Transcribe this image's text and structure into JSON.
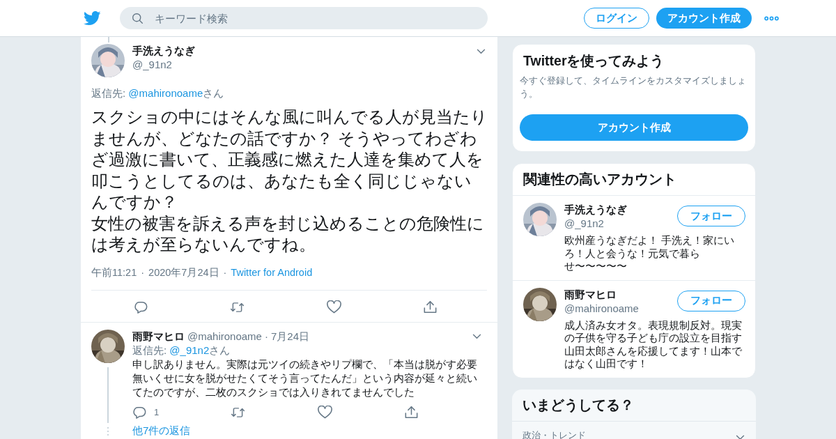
{
  "header": {
    "search": {
      "placeholder": "キーワード検索"
    },
    "login_button": "ログイン",
    "signup_button": "アカウント作成"
  },
  "tweet": {
    "name": "手洗えうなぎ",
    "handle": "@_91n2",
    "reply_to": {
      "prefix": "返信先:",
      "handle": "@mahironoame",
      "suffix": "さん"
    },
    "paragraphs": [
      "スクショの中にはそんな風に叫んでる人が見当たりませんが、どなたの話ですか？ そうやってわざわざ過激に書いて、正義感に燃えた人達を集めて人を叩こうとしてるのは、あなたも全く同じじゃないんですか？",
      "女性の被害を訴える声を封じ込めることの危険性には考えが至らないんですね。"
    ],
    "separator": "·",
    "time": "午前11:21",
    "date": "2020年7月24日",
    "source": "Twitter for Android",
    "actions": [
      {
        "kind": "reply"
      },
      {
        "kind": "retweet"
      },
      {
        "kind": "like"
      },
      {
        "kind": "share"
      }
    ]
  },
  "replies": [
    {
      "name": "雨野マヒロ",
      "handle": "@mahironoame",
      "separator": "·",
      "date": "7月24日",
      "reply_to": {
        "prefix": "返信先:",
        "handle": "@_91n2",
        "suffix": "さん"
      },
      "body": "申し訳ありません。実際は元ツイの続きやリプ欄で、「本当は脱がす必要無いくせに女を脱がせたくてそう言ってたんだ」という内容が延々と続いてたのですが、二枚のスクショでは入りきれてませんでした",
      "actions": [
        {
          "kind": "reply",
          "count": "1"
        },
        {
          "kind": "retweet"
        },
        {
          "kind": "like"
        },
        {
          "kind": "share"
        }
      ],
      "more_replies": "他7件の返信"
    }
  ],
  "sidebar": {
    "signup_card": {
      "title": "Twitterを使ってみよう",
      "text": "今すぐ登録して、タイムラインをカスタマイズしましょう。",
      "button": "アカウント作成"
    },
    "who_to_follow": {
      "title": "関連性の高いアカウント",
      "accounts": [
        {
          "name": "手洗えうなぎ",
          "handle": "@_91n2",
          "bio": "欧州産うなぎだよ！ 手洗え！家にいろ！人と会うな！元気で暮らせ〜〜〜〜〜",
          "button": "フォロー"
        },
        {
          "name": "雨野マヒロ",
          "handle": "@mahironoame",
          "bio": "成人済み女オタ。表現規制反対。現実の子供を守る子ども庁の設立を目指す山田太郎さんを応援してます！山本ではなく山田です！",
          "button": "フォロー"
        }
      ]
    },
    "trends": {
      "title": "いまどうしてる？",
      "items": [
        {
          "context": "政治・トレンド"
        }
      ]
    }
  }
}
